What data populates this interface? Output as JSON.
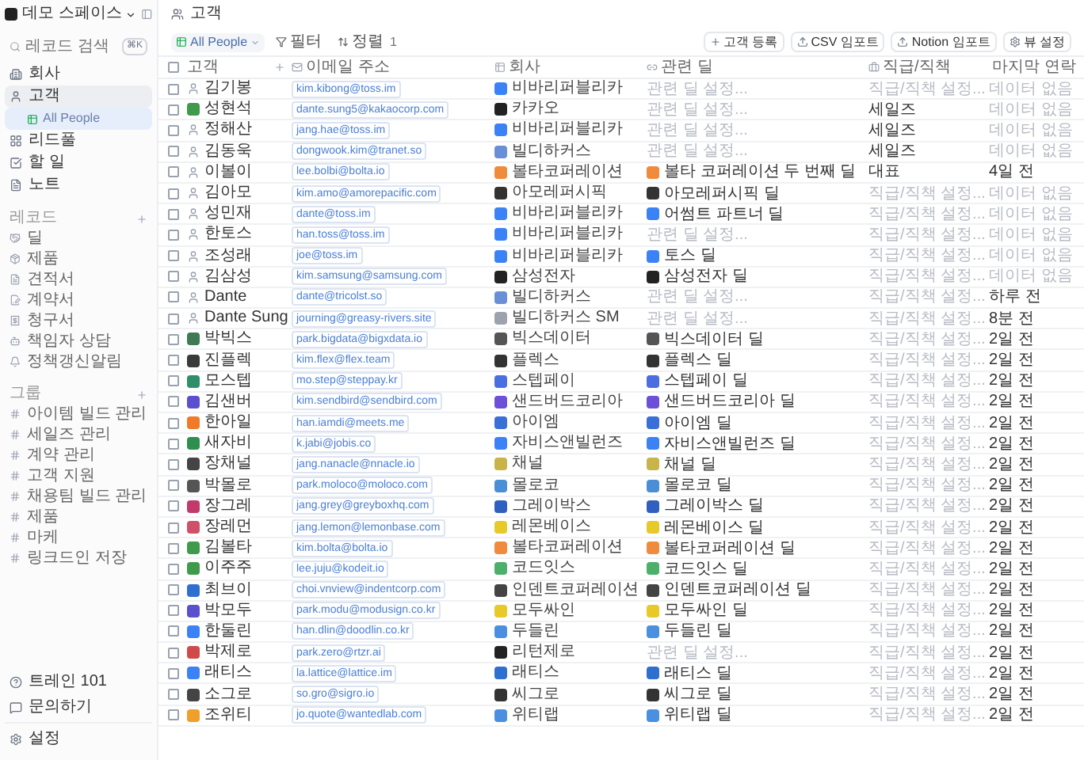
{
  "workspace": {
    "name": "데모 스페이스"
  },
  "sidebar": {
    "search": {
      "placeholder": "레코드 검색",
      "shortcut": "⌘K"
    },
    "nav": [
      {
        "label": "회사",
        "selected": false
      },
      {
        "label": "고객",
        "selected": true,
        "children": [
          {
            "label": "All People",
            "selected": true
          }
        ]
      },
      {
        "label": "리드풀",
        "selected": false
      },
      {
        "label": "할 일",
        "selected": false
      },
      {
        "label": "노트",
        "selected": false
      }
    ],
    "sections": [
      {
        "title": "레코드",
        "items": [
          "딜",
          "제품",
          "견적서",
          "계약서",
          "청구서",
          "책임자 상담",
          "정책갱신알림"
        ]
      },
      {
        "title": "그룹",
        "items": [
          "아이템 빌드 관리",
          "세일즈 관리",
          "계약 관리",
          "고객 지원",
          "채용팀 빌드 관리",
          "제품",
          "마케",
          "링크드인 저장"
        ]
      }
    ],
    "footer": [
      "트레인 101",
      "문의하기",
      "설정"
    ]
  },
  "header": {
    "title": "고객"
  },
  "toolbar": {
    "view": "All People",
    "filter": "필터",
    "sort": "정렬",
    "sort_count": "1",
    "actions": [
      "고객 등록",
      "CSV 임포트",
      "Notion 임포트",
      "뷰 설정"
    ]
  },
  "table": {
    "select_all": {
      "checked": false
    },
    "columns": [
      "고객",
      "이메일 주소",
      "회사",
      "관련 딜",
      "직급/직책",
      "마지막 연락"
    ],
    "rows": [
      {
        "checked": false,
        "name": "김기봉",
        "avatar": {
          "kind": "person"
        },
        "email": "kim.kibong@toss.im",
        "company": "비바리퍼블리카",
        "color": "#3b82f6",
        "deal": {
          "label": "관련 딜 설정...",
          "empty": true
        },
        "title": {
          "label": "직급/직책 설정...",
          "empty": true
        },
        "last": {
          "label": "데이터 없음",
          "empty": true
        }
      },
      {
        "checked": false,
        "name": "성현석",
        "avatar": {
          "kind": "logo",
          "color": "#3f9a4b"
        },
        "email": "dante.sung5@kakaocorp.com",
        "company": "카카오",
        "color": "#222222",
        "deal": {
          "label": "관련 딜 설정...",
          "empty": true
        },
        "title": {
          "label": "세일즈",
          "empty": false
        },
        "last": {
          "label": "데이터 없음",
          "empty": true
        }
      },
      {
        "checked": false,
        "name": "정해산",
        "avatar": {
          "kind": "person"
        },
        "email": "jang.hae@toss.im",
        "company": "비바리퍼블리카",
        "color": "#3b82f6",
        "deal": {
          "label": "관련 딜 설정...",
          "empty": true
        },
        "title": {
          "label": "세일즈",
          "empty": false
        },
        "last": {
          "label": "데이터 없음",
          "empty": true
        }
      },
      {
        "checked": false,
        "name": "김동욱",
        "avatar": {
          "kind": "person"
        },
        "email": "dongwook.kim@tranet.so",
        "company": "빌디하커스",
        "color": "#6b8fd6",
        "deal": {
          "label": "관련 딜 설정...",
          "empty": true
        },
        "title": {
          "label": "세일즈",
          "empty": false
        },
        "last": {
          "label": "데이터 없음",
          "empty": true
        }
      },
      {
        "checked": false,
        "name": "이볼이",
        "avatar": {
          "kind": "person"
        },
        "email": "lee.bolbi@bolta.io",
        "company": "볼타코퍼레이션",
        "color": "#f08a3c",
        "deal": {
          "label": "볼타 코퍼레이션 두 번째 딜",
          "empty": false
        },
        "title": {
          "label": "대표",
          "empty": false
        },
        "last": {
          "label": "4일 전",
          "empty": false
        }
      },
      {
        "checked": false,
        "name": "김아모",
        "avatar": {
          "kind": "person"
        },
        "email": "kim.amo@amorepacific.com",
        "company": "아모레퍼시픽",
        "color": "#333333",
        "deal": {
          "label": "아모레퍼시픽 딜",
          "empty": false
        },
        "title": {
          "label": "직급/직책 설정...",
          "empty": true
        },
        "last": {
          "label": "데이터 없음",
          "empty": true
        }
      },
      {
        "checked": false,
        "name": "성민재",
        "avatar": {
          "kind": "person"
        },
        "email": "dante@toss.im",
        "company": "비바리퍼블리카",
        "color": "#3b82f6",
        "deal": {
          "label": "어썸트 파트너 딜",
          "empty": false
        },
        "title": {
          "label": "직급/직책 설정...",
          "empty": true
        },
        "last": {
          "label": "데이터 없음",
          "empty": true
        }
      },
      {
        "checked": false,
        "name": "한토스",
        "avatar": {
          "kind": "person"
        },
        "email": "han.toss@toss.im",
        "company": "비바리퍼블리카",
        "color": "#3b82f6",
        "deal": {
          "label": "관련 딜 설정...",
          "empty": true
        },
        "title": {
          "label": "직급/직책 설정...",
          "empty": true
        },
        "last": {
          "label": "데이터 없음",
          "empty": true
        }
      },
      {
        "checked": false,
        "name": "조성래",
        "avatar": {
          "kind": "person"
        },
        "email": "joe@toss.im",
        "company": "비바리퍼블리카",
        "color": "#3b82f6",
        "deal": {
          "label": "토스 딜",
          "empty": false
        },
        "title": {
          "label": "직급/직책 설정...",
          "empty": true
        },
        "last": {
          "label": "데이터 없음",
          "empty": true
        }
      },
      {
        "checked": false,
        "name": "김삼성",
        "avatar": {
          "kind": "person"
        },
        "email": "kim.samsung@samsung.com",
        "company": "삼성전자",
        "color": "#222222",
        "deal": {
          "label": "삼성전자 딜",
          "empty": false
        },
        "title": {
          "label": "직급/직책 설정...",
          "empty": true
        },
        "last": {
          "label": "데이터 없음",
          "empty": true
        }
      },
      {
        "checked": false,
        "name": "Dante",
        "avatar": {
          "kind": "person"
        },
        "email": "dante@tricolst.so",
        "company": "빌디하커스",
        "color": "#6b8fd6",
        "deal": {
          "label": "관련 딜 설정...",
          "empty": true
        },
        "title": {
          "label": "직급/직책 설정...",
          "empty": true
        },
        "last": {
          "label": "하루 전",
          "empty": false
        }
      },
      {
        "checked": false,
        "name": "Dante Sung",
        "avatar": {
          "kind": "person"
        },
        "email": "journing@greasy-rivers.site",
        "company": "빌디하커스 SM",
        "color": "#9ca3af",
        "deal": {
          "label": "관련 딜 설정...",
          "empty": true
        },
        "title": {
          "label": "직급/직책 설정...",
          "empty": true
        },
        "last": {
          "label": "8분 전",
          "empty": false
        }
      },
      {
        "checked": false,
        "name": "박빅스",
        "avatar": {
          "kind": "logo",
          "color": "#3f7a55"
        },
        "email": "park.bigdata@bigxdata.io",
        "company": "빅스데이터",
        "color": "#555555",
        "deal": {
          "label": "빅스데이터 딜",
          "empty": false
        },
        "title": {
          "label": "직급/직책 설정...",
          "empty": true
        },
        "last": {
          "label": "2일 전",
          "empty": false
        }
      },
      {
        "checked": false,
        "name": "진플렉",
        "avatar": {
          "kind": "logo",
          "color": "#3a3a3a"
        },
        "email": "kim.flex@flex.team",
        "company": "플렉스",
        "color": "#333333",
        "deal": {
          "label": "플렉스 딜",
          "empty": false
        },
        "title": {
          "label": "직급/직책 설정...",
          "empty": true
        },
        "last": {
          "label": "2일 전",
          "empty": false
        }
      },
      {
        "checked": false,
        "name": "모스텝",
        "avatar": {
          "kind": "logo",
          "color": "#2f8f6a"
        },
        "email": "mo.step@steppay.kr",
        "company": "스텝페이",
        "color": "#4a6fe0",
        "deal": {
          "label": "스텝페이 딜",
          "empty": false
        },
        "title": {
          "label": "직급/직책 설정...",
          "empty": true
        },
        "last": {
          "label": "2일 전",
          "empty": false
        }
      },
      {
        "checked": false,
        "name": "김샌버",
        "avatar": {
          "kind": "logo",
          "color": "#5a4fcf"
        },
        "email": "kim.sendbird@sendbird.com",
        "company": "샌드버드코리아",
        "color": "#6d4fd8",
        "deal": {
          "label": "샌드버드코리아 딜",
          "empty": false
        },
        "title": {
          "label": "직급/직책 설정...",
          "empty": true
        },
        "last": {
          "label": "2일 전",
          "empty": false
        }
      },
      {
        "checked": false,
        "name": "한아일",
        "avatar": {
          "kind": "logo",
          "color": "#f07a2a"
        },
        "email": "han.iamdi@meets.me",
        "company": "아이엠",
        "color": "#3b6fd8",
        "deal": {
          "label": "아이엠 딜",
          "empty": false
        },
        "title": {
          "label": "직급/직책 설정...",
          "empty": true
        },
        "last": {
          "label": "2일 전",
          "empty": false
        }
      },
      {
        "checked": false,
        "name": "새자비",
        "avatar": {
          "kind": "logo",
          "color": "#2f8f4f"
        },
        "email": "k.jabi@jobis.co",
        "company": "자비스앤빌런즈",
        "color": "#3b82f6",
        "deal": {
          "label": "자비스앤빌런즈 딜",
          "empty": false
        },
        "title": {
          "label": "직급/직책 설정...",
          "empty": true
        },
        "last": {
          "label": "2일 전",
          "empty": false
        }
      },
      {
        "checked": false,
        "name": "장채널",
        "avatar": {
          "kind": "logo",
          "color": "#444444"
        },
        "email": "jang.nanacle@nnacle.io",
        "company": "채널",
        "color": "#c9b44a",
        "deal": {
          "label": "채널 딜",
          "empty": false
        },
        "title": {
          "label": "직급/직책 설정...",
          "empty": true
        },
        "last": {
          "label": "2일 전",
          "empty": false
        }
      },
      {
        "checked": false,
        "name": "박몰로",
        "avatar": {
          "kind": "logo",
          "color": "#555555"
        },
        "email": "park.moloco@moloco.com",
        "company": "몰로코",
        "color": "#4a8fd6",
        "deal": {
          "label": "몰로코 딜",
          "empty": false
        },
        "title": {
          "label": "직급/직책 설정...",
          "empty": true
        },
        "last": {
          "label": "2일 전",
          "empty": false
        }
      },
      {
        "checked": false,
        "name": "장그레",
        "avatar": {
          "kind": "logo",
          "color": "#c23a6a"
        },
        "email": "jang.grey@greyboxhq.com",
        "company": "그레이박스",
        "color": "#2f5fc0",
        "deal": {
          "label": "그레이박스 딜",
          "empty": false
        },
        "title": {
          "label": "직급/직책 설정...",
          "empty": true
        },
        "last": {
          "label": "2일 전",
          "empty": false
        }
      },
      {
        "checked": false,
        "name": "장레먼",
        "avatar": {
          "kind": "logo",
          "color": "#d0506a"
        },
        "email": "jang.lemon@lemonbase.com",
        "company": "레몬베이스",
        "color": "#e8c92a",
        "deal": {
          "label": "레몬베이스 딜",
          "empty": false
        },
        "title": {
          "label": "직급/직책 설정...",
          "empty": true
        },
        "last": {
          "label": "2일 전",
          "empty": false
        }
      },
      {
        "checked": false,
        "name": "김볼타",
        "avatar": {
          "kind": "logo",
          "color": "#3f9a4b"
        },
        "email": "kim.bolta@bolta.io",
        "company": "볼타코퍼레이션",
        "color": "#f08a3c",
        "deal": {
          "label": "볼타코퍼레이션 딜",
          "empty": false
        },
        "title": {
          "label": "직급/직책 설정...",
          "empty": true
        },
        "last": {
          "label": "2일 전",
          "empty": false
        }
      },
      {
        "checked": false,
        "name": "이주주",
        "avatar": {
          "kind": "logo",
          "color": "#3f9a4b"
        },
        "email": "lee.juju@kodeit.io",
        "company": "코드잇스",
        "color": "#4caf6a",
        "deal": {
          "label": "코드잇스 딜",
          "empty": false
        },
        "title": {
          "label": "직급/직책 설정...",
          "empty": true
        },
        "last": {
          "label": "2일 전",
          "empty": false
        }
      },
      {
        "checked": false,
        "name": "최브이",
        "avatar": {
          "kind": "logo",
          "color": "#2f6fd0"
        },
        "email": "choi.vnview@indentcorp.com",
        "company": "인덴트코퍼레이션",
        "color": "#444444",
        "deal": {
          "label": "인덴트코퍼레이션 딜",
          "empty": false
        },
        "title": {
          "label": "직급/직책 설정...",
          "empty": true
        },
        "last": {
          "label": "2일 전",
          "empty": false
        }
      },
      {
        "checked": false,
        "name": "박모두",
        "avatar": {
          "kind": "logo",
          "color": "#5a4fcf"
        },
        "email": "park.modu@modusign.co.kr",
        "company": "모두싸인",
        "color": "#e8c92a",
        "deal": {
          "label": "모두싸인 딜",
          "empty": false
        },
        "title": {
          "label": "직급/직책 설정...",
          "empty": true
        },
        "last": {
          "label": "2일 전",
          "empty": false
        }
      },
      {
        "checked": false,
        "name": "한둘린",
        "avatar": {
          "kind": "logo",
          "color": "#3b82f6"
        },
        "email": "han.dlin@doodlin.co.kr",
        "company": "두들린",
        "color": "#4a8fe0",
        "deal": {
          "label": "두들린 딜",
          "empty": false
        },
        "title": {
          "label": "직급/직책 설정...",
          "empty": true
        },
        "last": {
          "label": "2일 전",
          "empty": false
        }
      },
      {
        "checked": false,
        "name": "박제로",
        "avatar": {
          "kind": "logo",
          "color": "#d04a4a"
        },
        "email": "park.zero@rtzr.ai",
        "company": "리턴제로",
        "color": "#222222",
        "deal": {
          "label": "관련 딜 설정...",
          "empty": true
        },
        "title": {
          "label": "직급/직책 설정...",
          "empty": true
        },
        "last": {
          "label": "2일 전",
          "empty": false
        }
      },
      {
        "checked": false,
        "name": "래티스",
        "avatar": {
          "kind": "logo",
          "color": "#3b82f6"
        },
        "email": "la.lattice@lattice.im",
        "company": "래티스",
        "color": "#2f6fd0",
        "deal": {
          "label": "래티스 딜",
          "empty": false
        },
        "title": {
          "label": "직급/직책 설정...",
          "empty": true
        },
        "last": {
          "label": "2일 전",
          "empty": false
        }
      },
      {
        "checked": false,
        "name": "소그로",
        "avatar": {
          "kind": "logo",
          "color": "#444444"
        },
        "email": "so.gro@sigro.io",
        "company": "씨그로",
        "color": "#333333",
        "deal": {
          "label": "씨그로 딜",
          "empty": false
        },
        "title": {
          "label": "직급/직책 설정...",
          "empty": true
        },
        "last": {
          "label": "2일 전",
          "empty": false
        }
      },
      {
        "checked": false,
        "name": "조위티",
        "avatar": {
          "kind": "logo",
          "color": "#f0a02a"
        },
        "email": "jo.quote@wantedlab.com",
        "company": "위티랩",
        "color": "#4a8fe0",
        "deal": {
          "label": "위티랩 딜",
          "empty": false
        },
        "title": {
          "label": "직급/직책 설정...",
          "empty": true
        },
        "last": {
          "label": "2일 전",
          "empty": false
        }
      }
    ]
  }
}
